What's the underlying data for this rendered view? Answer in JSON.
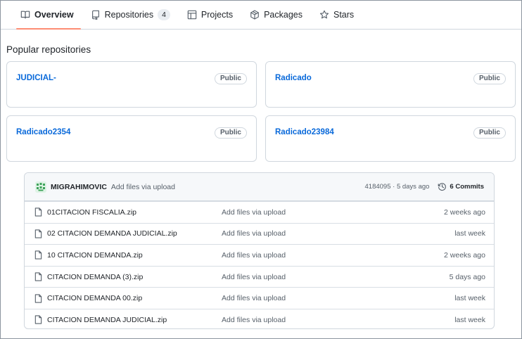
{
  "tabs": [
    {
      "label": "Overview",
      "icon": "book-icon",
      "active": true
    },
    {
      "label": "Repositories",
      "icon": "repo-icon",
      "counter": "4"
    },
    {
      "label": "Projects",
      "icon": "table-icon"
    },
    {
      "label": "Packages",
      "icon": "package-icon"
    },
    {
      "label": "Stars",
      "icon": "star-icon"
    }
  ],
  "popular": {
    "title": "Popular repositories",
    "repos": [
      {
        "name": "JUDICIAL-",
        "visibility": "Public"
      },
      {
        "name": "Radicado",
        "visibility": "Public"
      },
      {
        "name": "Radicado2354",
        "visibility": "Public"
      },
      {
        "name": "Radicado23984",
        "visibility": "Public"
      }
    ]
  },
  "commit": {
    "author": "MIGRAHIMOVIC",
    "message": "Add files via upload",
    "meta": "4184095 · 5 days ago",
    "commits_label": "6 Commits"
  },
  "files": [
    {
      "name": "01CITACION FISCALIA.zip",
      "message": "Add files via upload",
      "age": "2 weeks ago"
    },
    {
      "name": "02 CITACION DEMANDA JUDICIAL.zip",
      "message": "Add files via upload",
      "age": "last week"
    },
    {
      "name": "10 CITACION DEMANDA.zip",
      "message": "Add files via upload",
      "age": "2 weeks ago"
    },
    {
      "name": "CITACION DEMANDA (3).zip",
      "message": "Add files via upload",
      "age": "5 days ago"
    },
    {
      "name": "CITACION DEMANDA 00.zip",
      "message": "Add files via upload",
      "age": "last week"
    },
    {
      "name": "CITACION DEMANDA JUDICIAL.zip",
      "message": "Add files via upload",
      "age": "last week"
    }
  ],
  "colors": {
    "link": "#0969da",
    "tab_underline": "#fd8c73",
    "border": "#d0d7de"
  }
}
